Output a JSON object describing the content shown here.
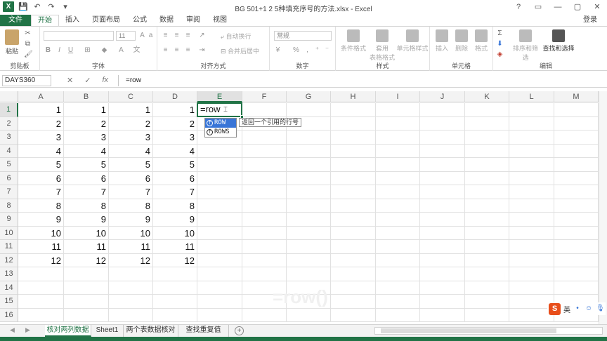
{
  "window": {
    "title": "BG 501+1 2 5种填充序号的方法.xlsx - Excel",
    "controls": [
      "?",
      "▭",
      "—",
      "▢",
      "✕"
    ]
  },
  "ribbon": {
    "tabs": [
      {
        "label": "文件",
        "name": "tab-file"
      },
      {
        "label": "开始",
        "name": "tab-home"
      },
      {
        "label": "插入",
        "name": "tab-insert"
      },
      {
        "label": "页面布局",
        "name": "tab-page-layout"
      },
      {
        "label": "公式",
        "name": "tab-formulas"
      },
      {
        "label": "数据",
        "name": "tab-data"
      },
      {
        "label": "审阅",
        "name": "tab-review"
      },
      {
        "label": "视图",
        "name": "tab-view"
      }
    ],
    "active_tab": "开始",
    "login": "登录",
    "groups": {
      "clipboard": "剪贴板",
      "font": "字体",
      "alignment": "对齐方式",
      "number": "数字",
      "styles": "样式",
      "cells": "单元格",
      "editing": "编辑"
    },
    "buttons": {
      "paste": "粘贴",
      "wrap_text": "自动换行",
      "merge_center": "合并后居中",
      "conditional_format": "条件格式",
      "format_table_1": "套用",
      "format_table_2": "表格格式",
      "cell_styles": "单元格样式",
      "insert": "插入",
      "delete": "删除",
      "format": "格式",
      "sort_filter": "排序和筛选",
      "find_select": "查找和选择"
    },
    "font_size": "11",
    "number_format": "常规"
  },
  "formula_bar": {
    "name_box": "DAYS360",
    "formula": "=row"
  },
  "columns": [
    "A",
    "B",
    "C",
    "D",
    "E",
    "F",
    "G",
    "H",
    "I",
    "J",
    "K",
    "L",
    "M"
  ],
  "rows": [
    "1",
    "2",
    "3",
    "4",
    "5",
    "6",
    "7",
    "8",
    "9",
    "10",
    "11",
    "12",
    "13",
    "14",
    "15",
    "16"
  ],
  "cells": {
    "A": [
      "1",
      "2",
      "3",
      "4",
      "5",
      "6",
      "7",
      "8",
      "9",
      "10",
      "11",
      "12"
    ],
    "B": [
      "1",
      "2",
      "3",
      "4",
      "5",
      "6",
      "7",
      "8",
      "9",
      "10",
      "11",
      "12"
    ],
    "C": [
      "1",
      "2",
      "3",
      "4",
      "5",
      "6",
      "7",
      "8",
      "9",
      "10",
      "11",
      "12"
    ],
    "D": [
      "1",
      "2",
      "3",
      "4",
      "5",
      "6",
      "7",
      "8",
      "9",
      "10",
      "11",
      "12"
    ]
  },
  "active_cell": {
    "ref": "E1",
    "value": "=row"
  },
  "autocomplete": {
    "items": [
      "ROW",
      "ROWS"
    ],
    "selected": "ROW",
    "tooltip": "返回一个引用的行号"
  },
  "watermark": "=row()",
  "ime": {
    "lang": "英"
  },
  "sheets": [
    {
      "label": "核对两列数据",
      "active": true
    },
    {
      "label": "Sheet1",
      "active": false
    },
    {
      "label": "两个表数据核对",
      "active": false
    },
    {
      "label": "查找重复值",
      "active": false
    }
  ],
  "colors": {
    "accent": "#217346",
    "selection_blue": "#3875d7",
    "ime_logo": "#e84e1b"
  }
}
